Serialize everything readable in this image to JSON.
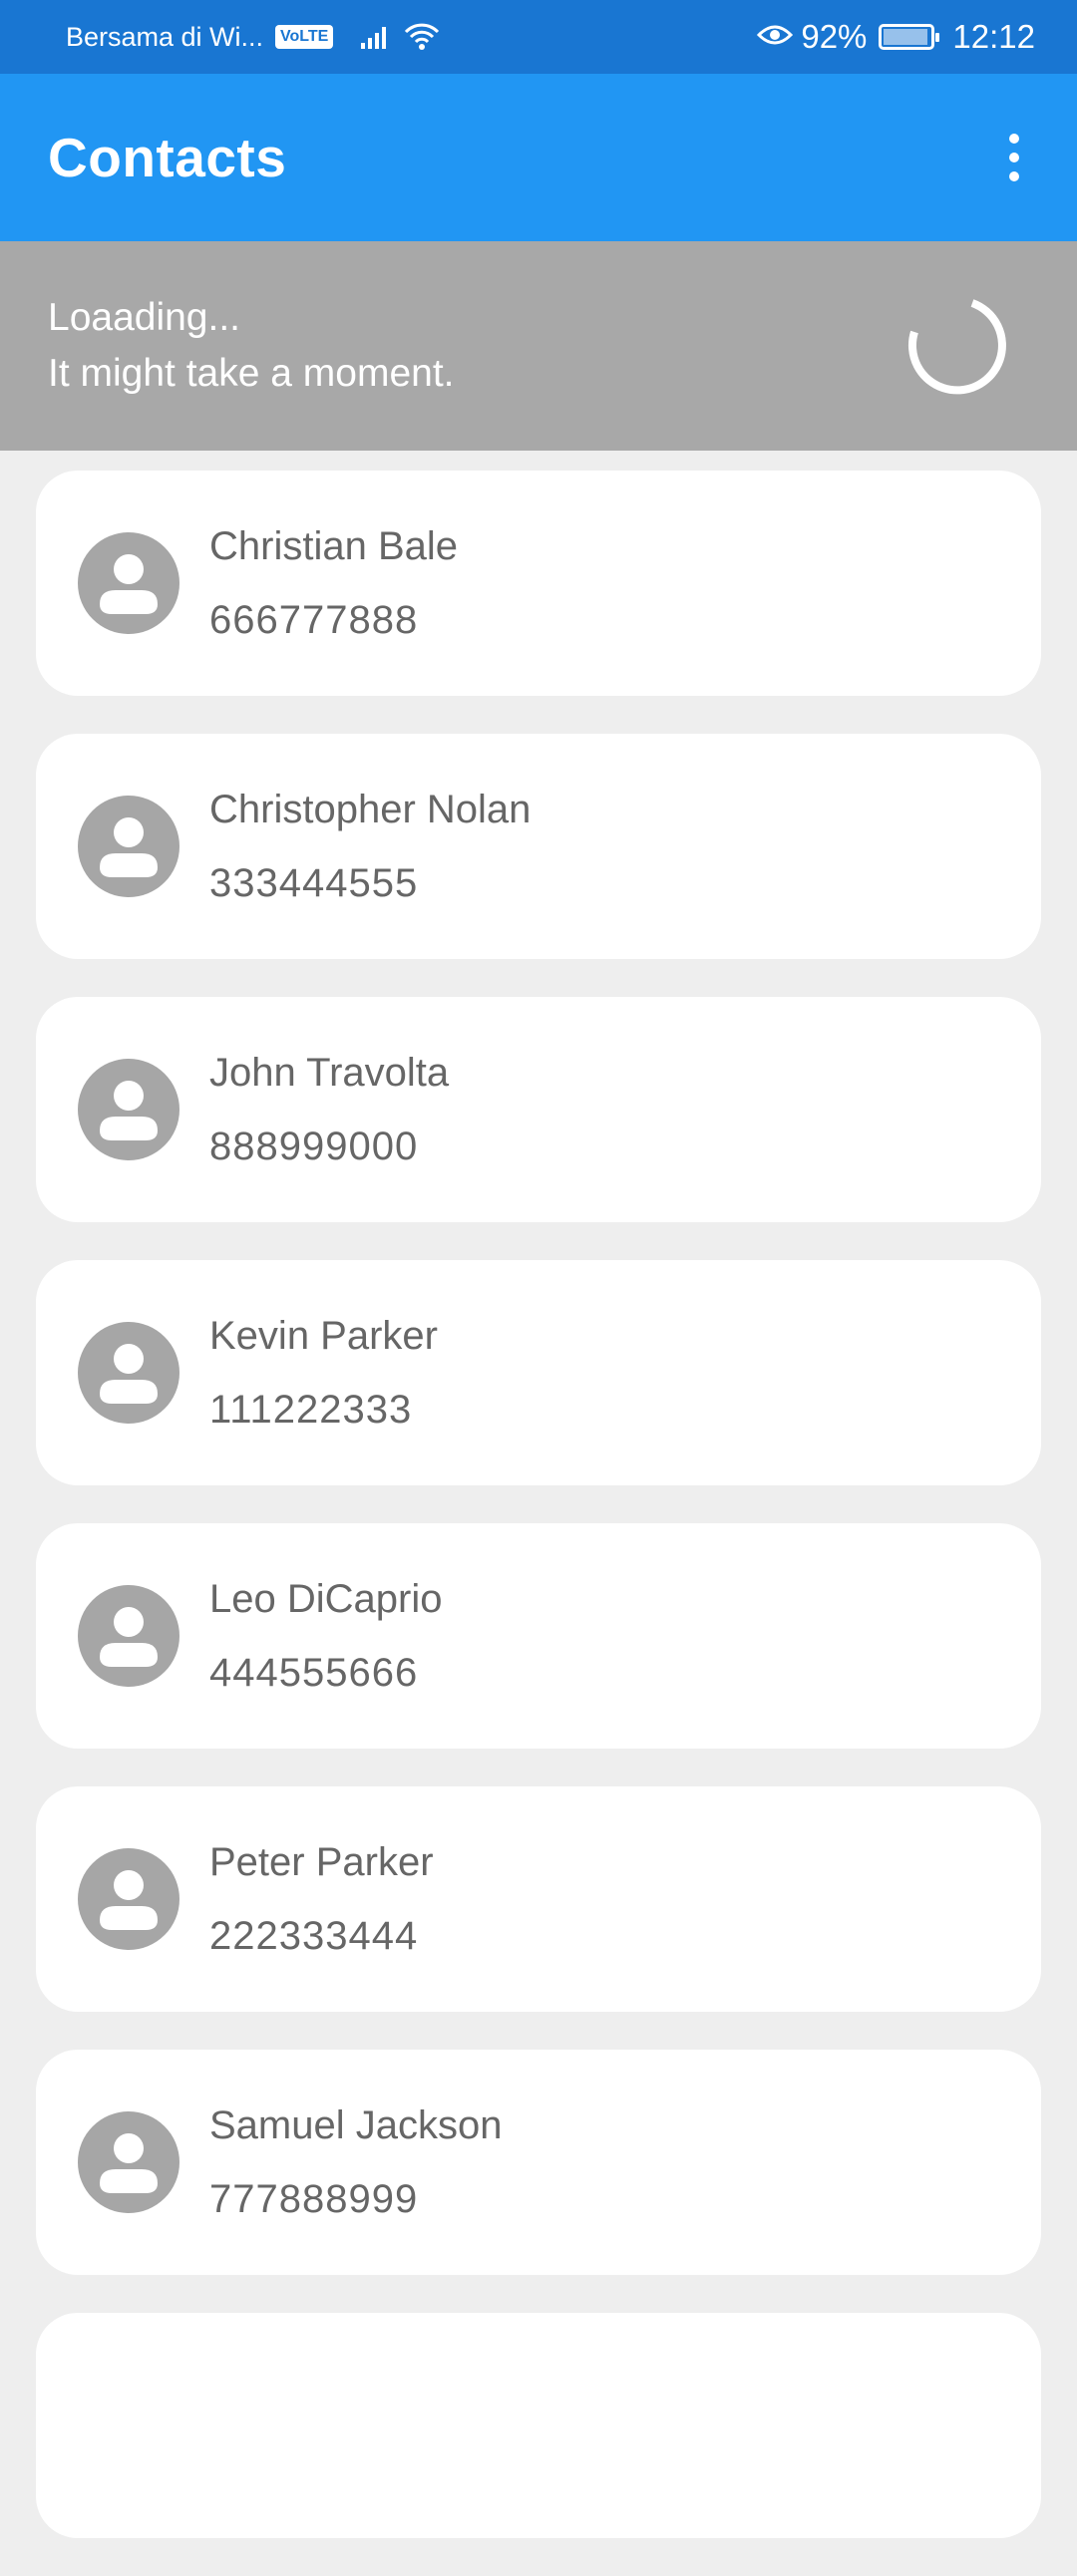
{
  "status_bar": {
    "carrier": "Bersama di Wi...",
    "volte": "VoLTE",
    "battery_percent": "92%",
    "time": "12:12"
  },
  "app_bar": {
    "title": "Contacts",
    "menu_icon": "more-vert-icon"
  },
  "loading": {
    "line1": "Loaading...",
    "line2": "It might take a moment."
  },
  "contacts": [
    {
      "name": "Christian Bale",
      "phone": "666777888"
    },
    {
      "name": "Christopher Nolan",
      "phone": "333444555"
    },
    {
      "name": "John Travolta",
      "phone": "888999000"
    },
    {
      "name": "Kevin Parker",
      "phone": "111222333"
    },
    {
      "name": "Leo DiCaprio",
      "phone": "444555666"
    },
    {
      "name": "Peter Parker",
      "phone": "222333444"
    },
    {
      "name": "Samuel Jackson",
      "phone": "777888999"
    }
  ],
  "colors": {
    "status_bar": "#1976d2",
    "app_bar": "#2196f3",
    "banner": "#a8a8a8",
    "avatar": "#a6a6a6",
    "background": "#eeeeee"
  }
}
